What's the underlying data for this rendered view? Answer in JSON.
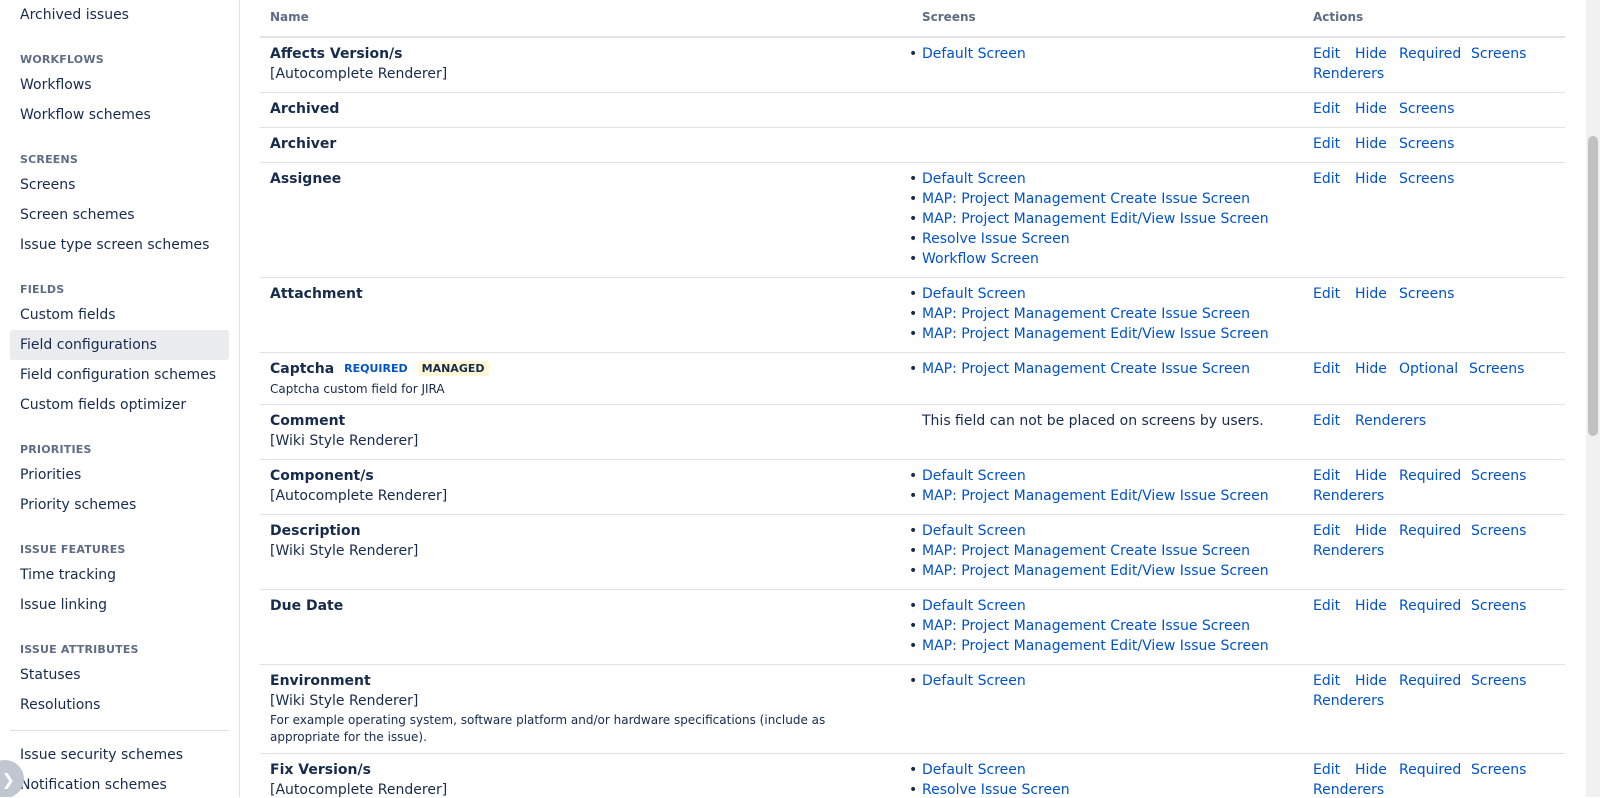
{
  "sidebar": {
    "top_item": "Archived issues",
    "sections": {
      "workflows": {
        "heading": "WORKFLOWS",
        "items": [
          "Workflows",
          "Workflow schemes"
        ]
      },
      "screens": {
        "heading": "SCREENS",
        "items": [
          "Screens",
          "Screen schemes",
          "Issue type screen schemes"
        ]
      },
      "fields": {
        "heading": "FIELDS",
        "items": [
          "Custom fields",
          "Field configurations",
          "Field configuration schemes",
          "Custom fields optimizer"
        ]
      },
      "priorities": {
        "heading": "PRIORITIES",
        "items": [
          "Priorities",
          "Priority schemes"
        ]
      },
      "issue_features": {
        "heading": "ISSUE FEATURES",
        "items": [
          "Time tracking",
          "Issue linking"
        ]
      },
      "issue_attributes": {
        "heading": "ISSUE ATTRIBUTES",
        "items": [
          "Statuses",
          "Resolutions"
        ]
      }
    },
    "bottom_items": [
      "Issue security schemes",
      "Notification schemes"
    ],
    "active_item": "Field configurations",
    "collapse_icon": "chevron-right-icon"
  },
  "table": {
    "headers": {
      "name": "Name",
      "screens": "Screens",
      "actions": "Actions"
    },
    "rows": [
      {
        "name": "Affects Version/s",
        "renderer": "[Autocomplete Renderer]",
        "screens": [
          "Default Screen"
        ],
        "actions": [
          "Edit",
          "Hide",
          "Required",
          "Screens",
          "Renderers"
        ]
      },
      {
        "name": "Archived",
        "screens": [],
        "actions": [
          "Edit",
          "Hide",
          "Screens"
        ]
      },
      {
        "name": "Archiver",
        "screens": [],
        "actions": [
          "Edit",
          "Hide",
          "Screens"
        ]
      },
      {
        "name": "Assignee",
        "screens": [
          "Default Screen",
          "MAP: Project Management Create Issue Screen",
          "MAP: Project Management Edit/View Issue Screen",
          "Resolve Issue Screen",
          "Workflow Screen"
        ],
        "actions": [
          "Edit",
          "Hide",
          "Screens"
        ]
      },
      {
        "name": "Attachment",
        "screens": [
          "Default Screen",
          "MAP: Project Management Create Issue Screen",
          "MAP: Project Management Edit/View Issue Screen"
        ],
        "actions": [
          "Edit",
          "Hide",
          "Screens"
        ]
      },
      {
        "name": "Captcha",
        "badges": [
          "REQUIRED",
          "MANAGED"
        ],
        "description": "Captcha custom field for JIRA",
        "screens": [
          "MAP: Project Management Create Issue Screen"
        ],
        "actions": [
          "Edit",
          "Hide",
          "Optional",
          "Screens"
        ]
      },
      {
        "name": "Comment",
        "renderer": "[Wiki Style Renderer]",
        "screens_note": "This field can not be placed on screens by users.",
        "actions": [
          "Edit",
          "Renderers"
        ]
      },
      {
        "name": "Component/s",
        "renderer": "[Autocomplete Renderer]",
        "screens": [
          "Default Screen",
          "MAP: Project Management Edit/View Issue Screen"
        ],
        "actions": [
          "Edit",
          "Hide",
          "Required",
          "Screens",
          "Renderers"
        ]
      },
      {
        "name": "Description",
        "renderer": "[Wiki Style Renderer]",
        "screens": [
          "Default Screen",
          "MAP: Project Management Create Issue Screen",
          "MAP: Project Management Edit/View Issue Screen"
        ],
        "actions": [
          "Edit",
          "Hide",
          "Required",
          "Screens",
          "Renderers"
        ]
      },
      {
        "name": "Due Date",
        "screens": [
          "Default Screen",
          "MAP: Project Management Create Issue Screen",
          "MAP: Project Management Edit/View Issue Screen"
        ],
        "actions": [
          "Edit",
          "Hide",
          "Required",
          "Screens"
        ]
      },
      {
        "name": "Environment",
        "renderer": "[Wiki Style Renderer]",
        "description": "For example operating system, software platform and/or hardware specifications (include as appropriate for the issue).",
        "screens": [
          "Default Screen"
        ],
        "actions": [
          "Edit",
          "Hide",
          "Required",
          "Screens",
          "Renderers"
        ]
      },
      {
        "name": "Fix Version/s",
        "renderer": "[Autocomplete Renderer]",
        "screens": [
          "Default Screen",
          "Resolve Issue Screen"
        ],
        "actions": [
          "Edit",
          "Hide",
          "Required",
          "Screens",
          "Renderers"
        ]
      }
    ]
  },
  "colors": {
    "link": "#0052cc",
    "text": "#172b4d",
    "muted": "#5e6c84",
    "active_bg": "#ebecf0",
    "managed_bg": "#fff7d6"
  }
}
